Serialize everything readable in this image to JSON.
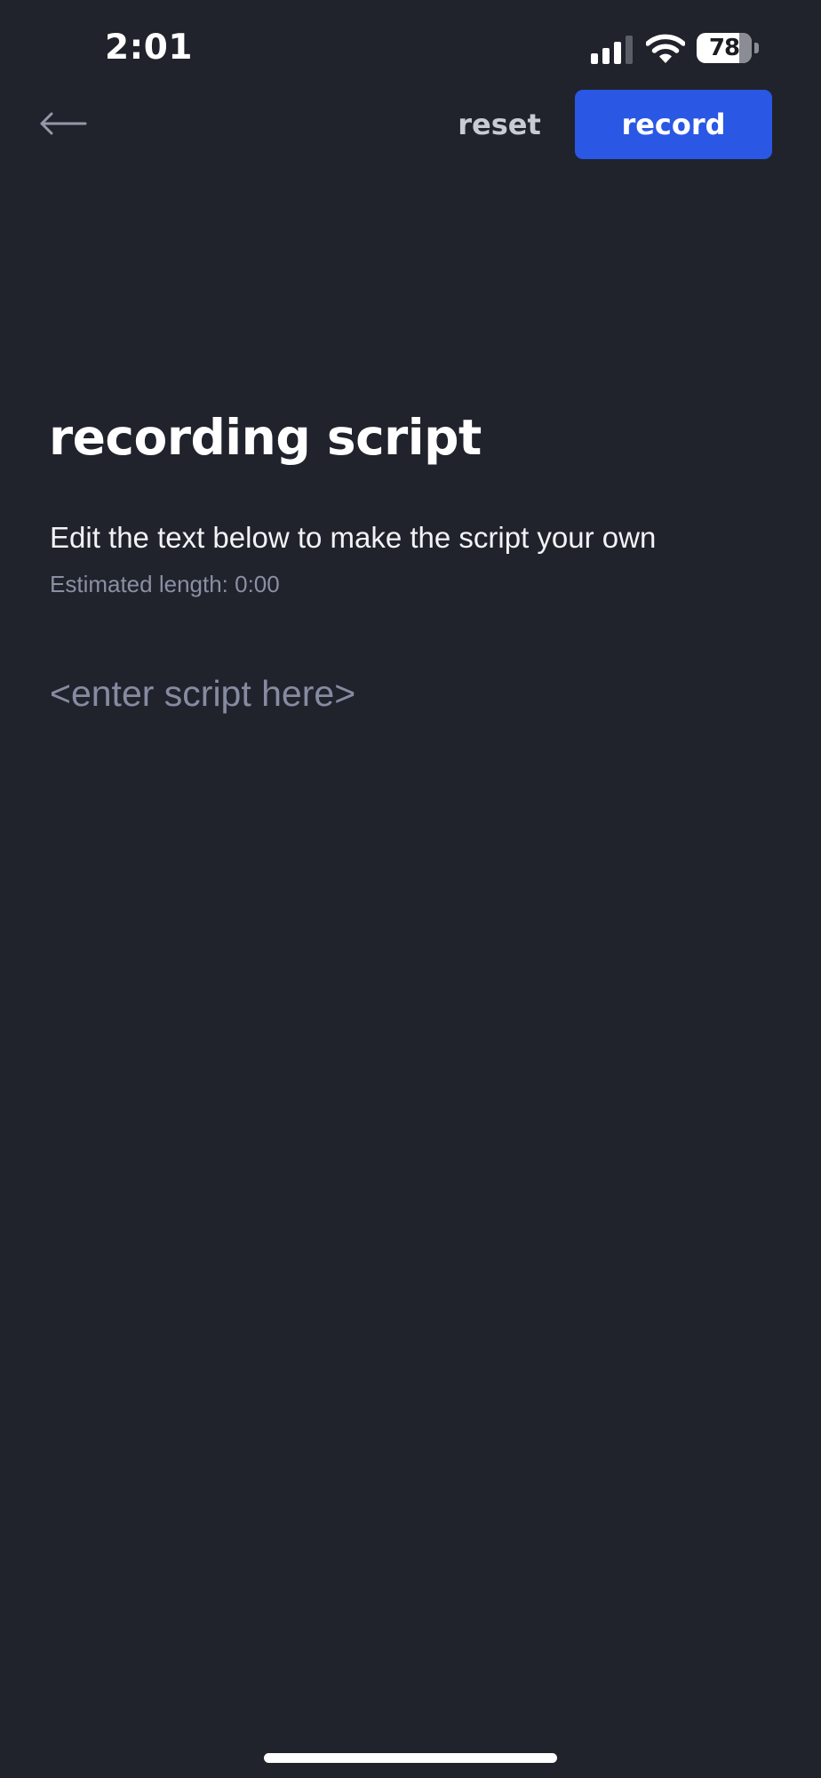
{
  "status_bar": {
    "time": "2:01",
    "battery_level": "78",
    "battery_fraction": 0.78,
    "signal_bars_active": 3,
    "signal_bars_total": 4,
    "icons": {
      "signal": "cellular-signal-icon",
      "wifi": "wifi-icon",
      "battery": "battery-icon"
    }
  },
  "nav": {
    "back_icon": "back-arrow-icon",
    "reset_label": "reset",
    "record_label": "record"
  },
  "page": {
    "title": "recording script",
    "instructions": "Edit the text below to make the script your own",
    "estimated_length": "Estimated length: 0:00"
  },
  "script_editor": {
    "value": "",
    "placeholder": "<enter script here>"
  },
  "colors": {
    "background": "#20232c",
    "accent": "#2a57e4",
    "muted_text": "#8a8fa3",
    "placeholder_text": "#868ba2"
  }
}
